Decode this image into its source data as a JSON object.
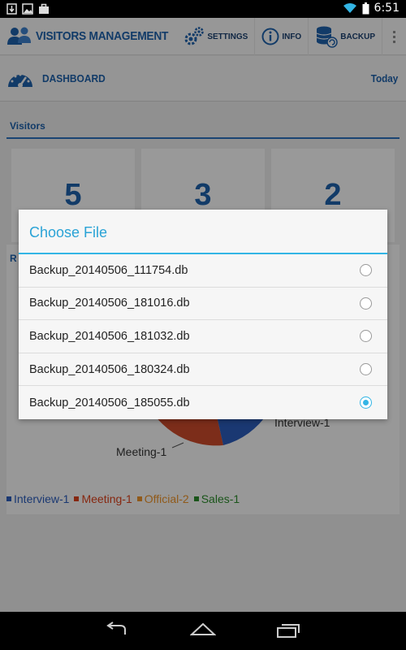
{
  "status_bar": {
    "time": "6:51",
    "icons": [
      "download-icon",
      "image-icon",
      "briefcase-icon",
      "wifi-icon",
      "battery-icon"
    ]
  },
  "app_bar": {
    "title": "VISITORS MANAGEMENT",
    "actions": [
      {
        "label": "SETTINGS",
        "icon": "gears-icon"
      },
      {
        "label": "INFO",
        "icon": "info-icon"
      },
      {
        "label": "BACKUP",
        "icon": "database-icon"
      }
    ],
    "overflow_icon": "overflow-menu-icon"
  },
  "dashboard": {
    "title": "DASHBOARD",
    "period": "Today",
    "icon": "speedometer-icon"
  },
  "visitors": {
    "section_title": "Visitors",
    "cards": [
      "5",
      "3",
      "2"
    ]
  },
  "report": {
    "title_partial": "R",
    "pie_labels": {
      "interview": "Interview-1",
      "meeting": "Meeting-1"
    },
    "legend": [
      {
        "label": "Interview-1",
        "color": "#2a5bb8"
      },
      {
        "label": "Meeting-1",
        "color": "#d8401a"
      },
      {
        "label": "Official-2",
        "color": "#e8912a"
      },
      {
        "label": "Sales-1",
        "color": "#2a8a2a"
      }
    ]
  },
  "dialog": {
    "title": "Choose File",
    "accent_color": "#33b5e5",
    "files": [
      {
        "name": "Backup_20140506_111754.db",
        "selected": false
      },
      {
        "name": "Backup_20140506_181016.db",
        "selected": false
      },
      {
        "name": "Backup_20140506_181032.db",
        "selected": false
      },
      {
        "name": "Backup_20140506_180324.db",
        "selected": false
      },
      {
        "name": "Backup_20140506_185055.db",
        "selected": true
      }
    ]
  },
  "nav_bar": {
    "buttons": [
      "back-icon",
      "home-icon",
      "recent-apps-icon"
    ]
  }
}
